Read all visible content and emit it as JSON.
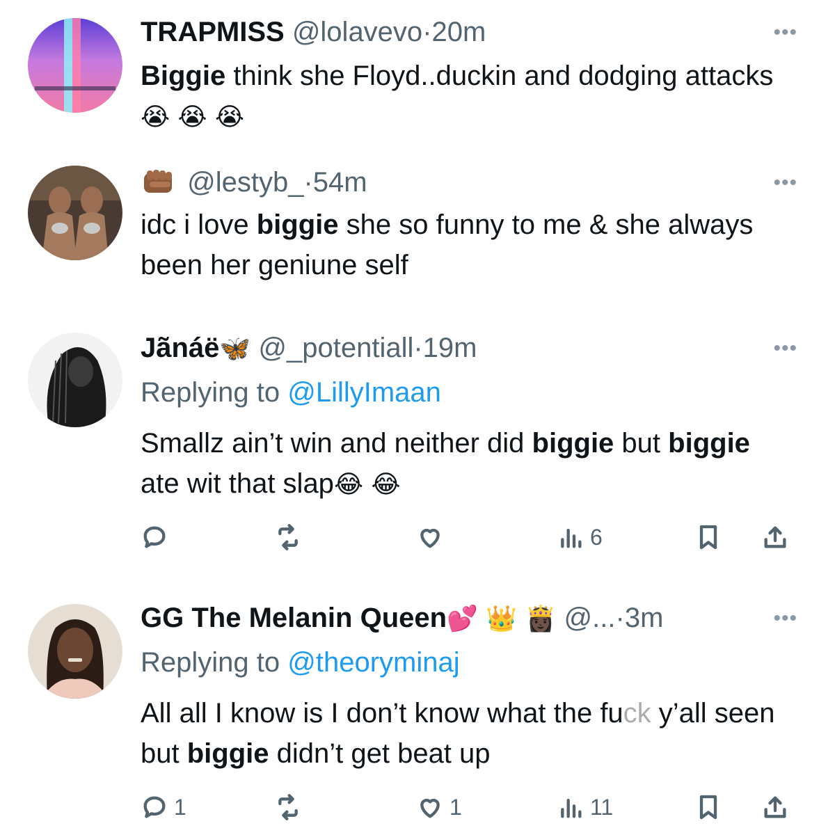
{
  "posts": [
    {
      "display_name": "TRAPMISS",
      "handle": "@lolavevo",
      "time": "20m",
      "text_bold_1": "Biggie",
      "text_1": " think she Floyd..duckin and dodging attacks ",
      "emojis": "😭 😭 😭",
      "more": "•••"
    },
    {
      "name_icon": "fist-emoji-icon",
      "handle": "@lestyb_",
      "time": "54m",
      "text_1": "idc i love ",
      "text_bold_1": "biggie",
      "text_2": " she so funny to me & she always been her geniune self",
      "more": "•••"
    },
    {
      "display_name": "Jãnáë",
      "name_emoji": "🦋",
      "handle": "@_potentiall",
      "time": "19m",
      "replying_prefix": "Replying to ",
      "replying_to": "@LillyImaan",
      "text_1": "Smallz ain’t win and neither did ",
      "text_bold_1": "biggie",
      "text_2": " but ",
      "text_bold_2": "biggie",
      "text_3": " ate wit that slap",
      "emojis": "😂 😂",
      "more": "•••",
      "actions": {
        "replies": "",
        "reposts": "",
        "likes": "",
        "views": "6"
      }
    },
    {
      "display_name": "GG The Melanin Queen",
      "name_emojis": "💕 👑 👸🏿",
      "handle": "@...",
      "time": "3m",
      "replying_prefix": "Replying to ",
      "replying_to": "@theoryminaj",
      "text_1": "All all I know is I don’t know what the fu",
      "text_censored": "ck",
      "text_2": " y’all seen but ",
      "text_bold_1": "biggie",
      "text_3": " didn’t get beat up",
      "more": "•••",
      "actions": {
        "replies": "1",
        "reposts": "",
        "likes": "1",
        "views": "11"
      }
    }
  ],
  "separator": "·",
  "icons": [
    "reply-icon",
    "repost-icon",
    "like-icon",
    "views-icon",
    "bookmark-icon",
    "share-icon"
  ]
}
